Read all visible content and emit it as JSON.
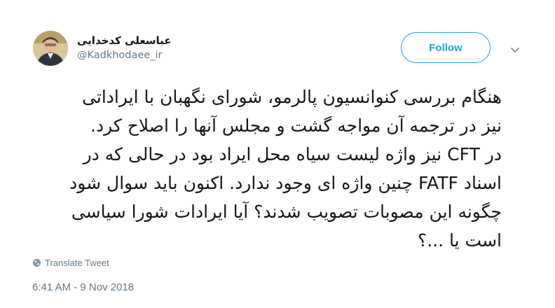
{
  "author": {
    "name": "عباسعلی کدخدایی",
    "handle": "@Kadkhodaee_ir",
    "avatar_icon": "profile-photo"
  },
  "follow_label": "Follow",
  "tweet": {
    "lines": [
      "هنگام بررسی کنوانسیون پالرمو، شورای نگهبان با ایراداتی",
      "نیز در ترجمه آن مواجه گشت و مجلس آنها را اصلاح کرد.",
      "در CFT نیز واژه لیست سیاه محل ایراد بود در حالی که در",
      "اسناد FATF چنین واژه ای وجود ندارد. اکنون باید سوال شود",
      "چگونه این مصوبات تصویب شدند؟ آیا ایرادات شورا سیاسی",
      "است یا ...؟"
    ]
  },
  "translate_label": "Translate Tweet",
  "timestamp": "6:41 AM - 9 Nov 2018",
  "colors": {
    "accent": "#1da1f2",
    "text": "#14171a",
    "muted": "#657786"
  }
}
